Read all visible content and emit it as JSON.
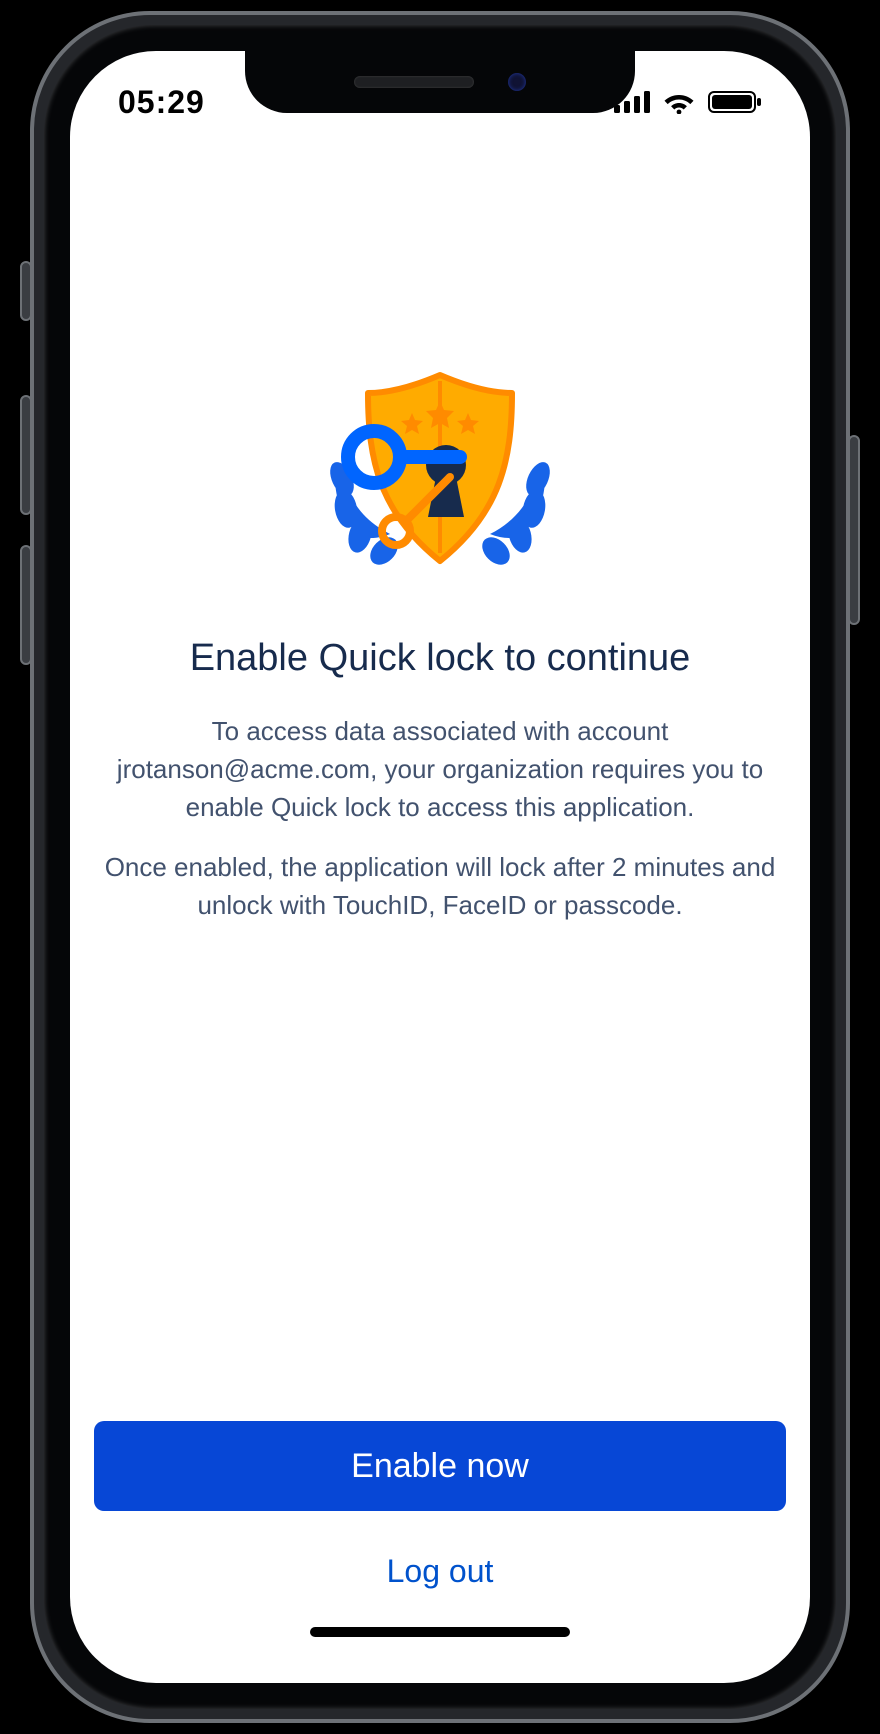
{
  "status_bar": {
    "time": "05:29"
  },
  "screen": {
    "title": "Enable Quick lock to continue",
    "paragraph1": "To access data associated with account jrotanson@acme.com, your organization requires you to enable Quick lock to access this application.",
    "paragraph2": "Once enabled, the application will lock after 2 minutes and unlock with TouchID, FaceID or passcode."
  },
  "buttons": {
    "primary": "Enable now",
    "secondary": "Log out"
  },
  "colors": {
    "brand_blue": "#0747D6",
    "link_blue": "#0052CC",
    "heading": "#172B4D",
    "body": "#42526E",
    "shield_fill": "#FFAB00",
    "shield_stroke": "#FF8B00",
    "laurel": "#1864E8"
  }
}
